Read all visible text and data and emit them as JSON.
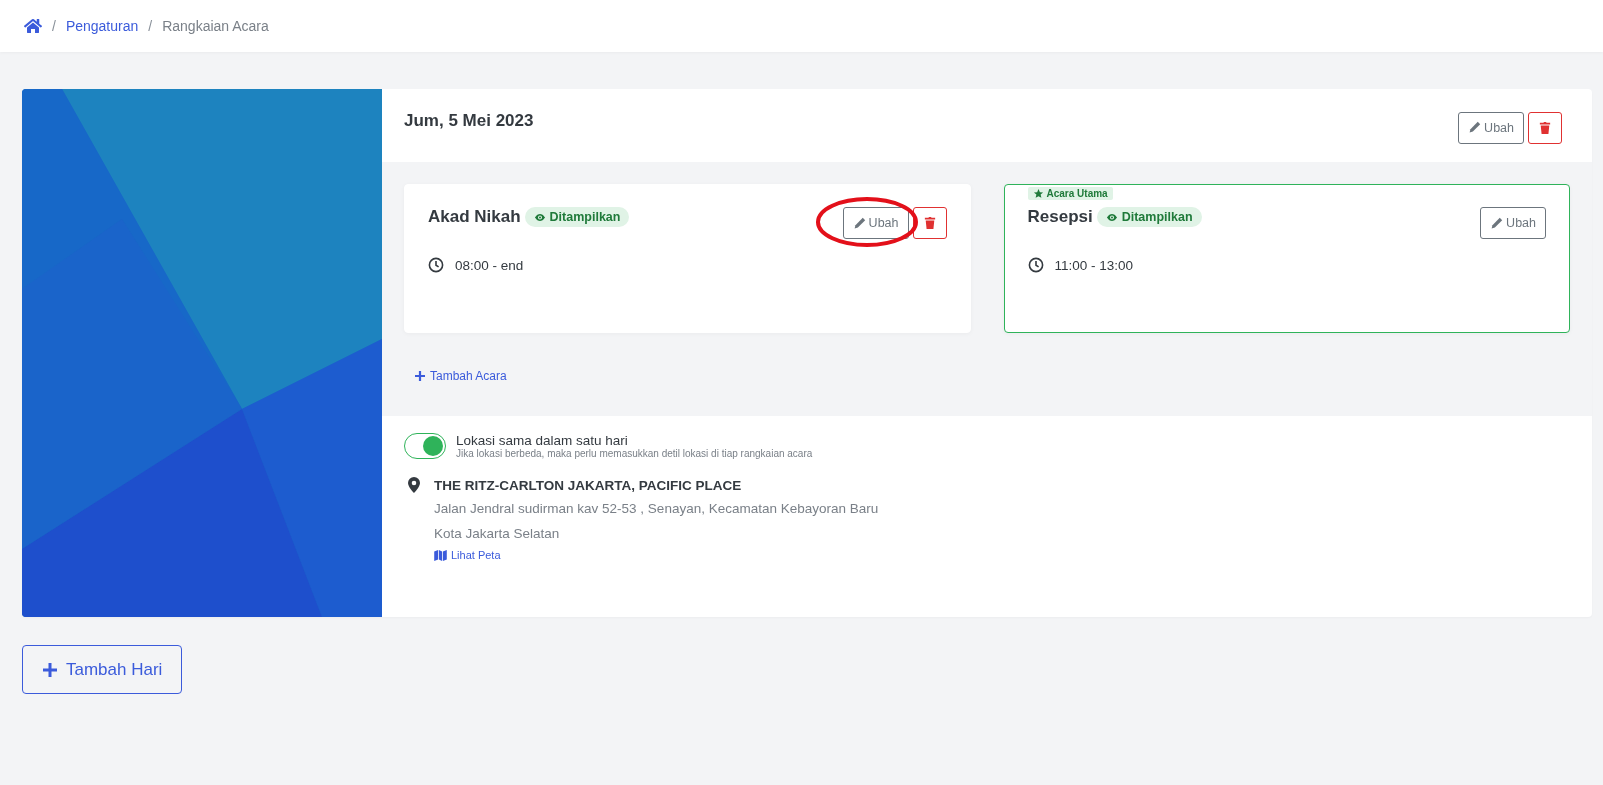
{
  "breadcrumb": {
    "separator": "/",
    "items": [
      {
        "label": "Pengaturan",
        "kind": "link"
      },
      {
        "label": "Rangkaian Acara",
        "kind": "current"
      }
    ]
  },
  "day": {
    "title": "Jum, 5 Mei 2023",
    "edit_label": "Ubah",
    "events": [
      {
        "name": "Akad Nikah",
        "status": "Ditampilkan",
        "visible": true,
        "time": "08:00 - end",
        "main": false,
        "edit_label": "Ubah",
        "highlighted": true
      },
      {
        "name": "Resepsi",
        "status": "Ditampilkan",
        "visible": true,
        "time": "11:00 - 13:00",
        "main": true,
        "main_label": "Acara Utama",
        "edit_label": "Ubah",
        "highlighted": false
      }
    ],
    "add_event": "Tambah Acara",
    "location": {
      "toggle_label": "Lokasi sama dalam satu hari",
      "toggle_hint": "Jika lokasi berbeda, maka perlu memasukkan detil lokasi di tiap rangkaian acara",
      "same": true,
      "venue": "THE RITZ-CARLTON JAKARTA, PACIFIC PLACE",
      "address_lines": [
        "Jalan Jendral sudirman kav 52-53 , Senayan, Kecamatan Kebayoran Baru",
        "Kota Jakarta Selatan"
      ],
      "map_link": "Lihat Peta"
    }
  },
  "add_day": "Tambah Hari"
}
